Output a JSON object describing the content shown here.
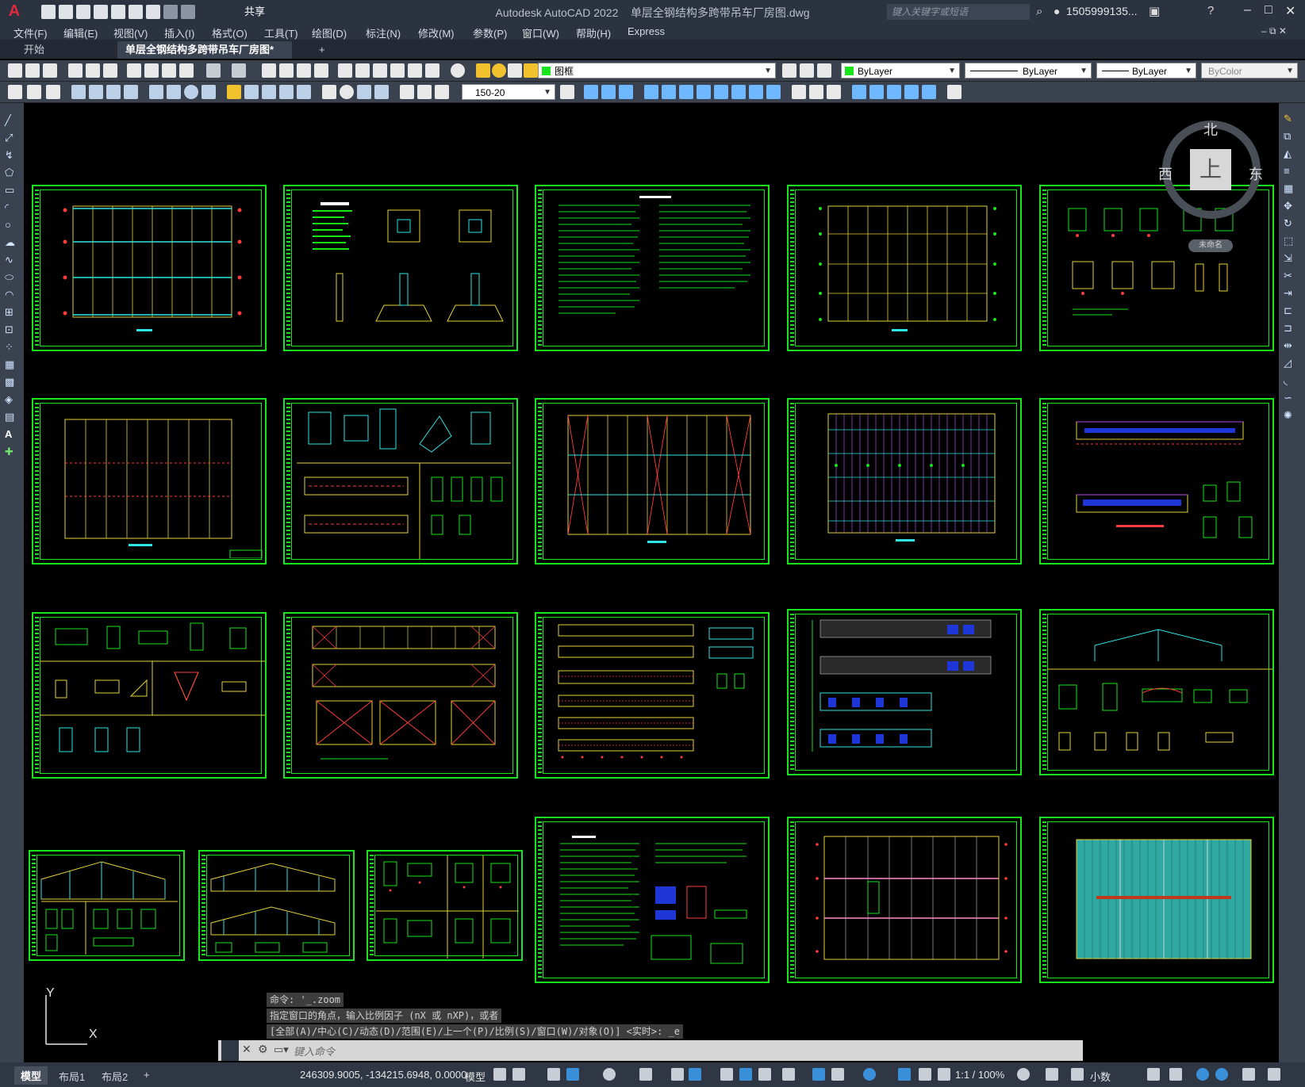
{
  "app": {
    "title": "Autodesk AutoCAD 2022",
    "filename": "单层全钢结构多跨带吊车厂房图.dwg",
    "share_label": "共享",
    "search_placeholder": "键入关键字或短语",
    "user": "1505999135..."
  },
  "menu": [
    "文件(F)",
    "编辑(E)",
    "视图(V)",
    "插入(I)",
    "格式(O)",
    "工具(T)",
    "绘图(D)",
    "标注(N)",
    "修改(M)",
    "参数(P)",
    "窗口(W)",
    "帮助(H)",
    "Express"
  ],
  "tabs": {
    "start": "开始",
    "active": "单层全钢结构多跨带吊车厂房图*",
    "close": "×",
    "add": "+"
  },
  "toolbar": {
    "layer_name": "图框",
    "color": "ByLayer",
    "linetype": "ByLayer",
    "lineweight": "ByLayer",
    "plotstyle": "ByColor",
    "dimstyle": "150-20"
  },
  "viewcube": {
    "north": "北",
    "west": "西",
    "east": "东",
    "top": "上",
    "wcs": "未命名"
  },
  "ucs": {
    "y": "Y",
    "x": "X"
  },
  "command": {
    "history": [
      "命令: '_.zoom",
      "指定窗口的角点，输入比例因子 (nX 或 nXP)，或者",
      "[全部(A)/中心(C)/动态(D)/范围(E)/上一个(P)/比例(S)/窗口(W)/对象(O)] <实时>: _e"
    ],
    "placeholder": "键入命令"
  },
  "status": {
    "layouts": [
      "模型",
      "布局1",
      "布局2"
    ],
    "add": "+",
    "coords": "246309.9005, -134215.6948, 0.0000",
    "space": "模型",
    "scale": "1:1 / 100%",
    "units": "小数"
  },
  "colors": {
    "sheet_border": "#19e51c",
    "canvas": "#000000",
    "chrome": "#3a4250"
  }
}
